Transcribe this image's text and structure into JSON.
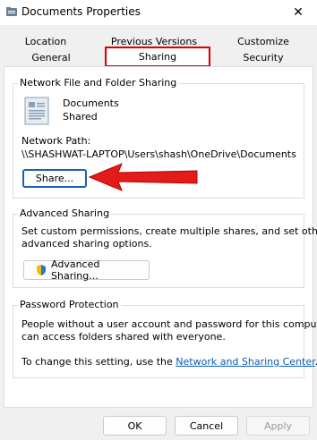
{
  "window": {
    "title": "Documents Properties",
    "close_glyph": "✕"
  },
  "tabs": {
    "row1": [
      "Location",
      "Previous Versions",
      "Customize"
    ],
    "row2": [
      "General",
      "Sharing",
      "Security"
    ],
    "active": "Sharing"
  },
  "network_sharing": {
    "legend": "Network File and Folder Sharing",
    "folder_name": "Documents",
    "folder_status": "Shared",
    "path_label": "Network Path:",
    "path_value": "\\\\SHASHWAT-LAPTOP\\Users\\shash\\OneDrive\\Documents",
    "share_button": "Share..."
  },
  "advanced_sharing": {
    "legend": "Advanced Sharing",
    "description_line1": "Set custom permissions, create multiple shares, and set other",
    "description_line2": "advanced sharing options.",
    "button": "Advanced Sharing..."
  },
  "password_protection": {
    "legend": "Password Protection",
    "line1": "People without a user account and password for this computer",
    "line2": "can access folders shared with everyone.",
    "line3_prefix": "To change this setting, use the ",
    "link_text": "Network and Sharing Center",
    "line3_suffix": "."
  },
  "footer": {
    "ok": "OK",
    "cancel": "Cancel",
    "apply": "Apply"
  },
  "colors": {
    "highlight": "#e00000",
    "link": "#0a5bb8",
    "focus_border": "#1c5fb5"
  }
}
